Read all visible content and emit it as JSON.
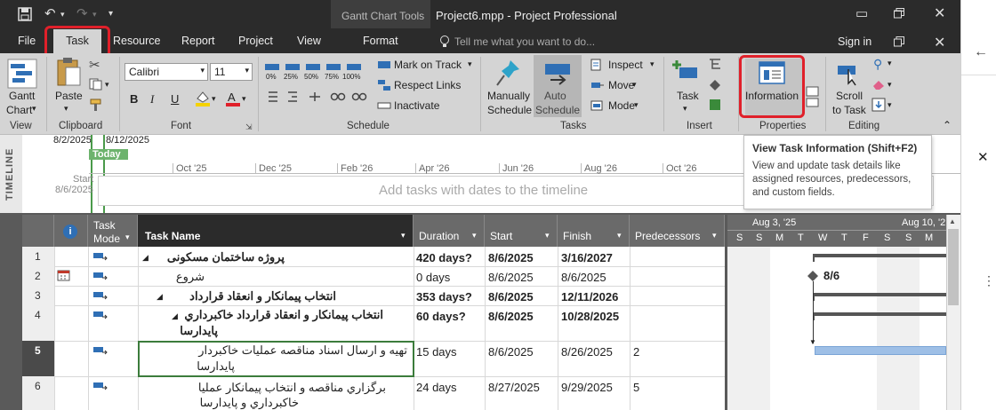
{
  "titlebar": {
    "context_tab": "Gantt Chart Tools",
    "title": "Project6.mpp  -  Project Professional"
  },
  "tabs": [
    "File",
    "Task",
    "Resource",
    "Report",
    "Project",
    "View",
    "Format"
  ],
  "tell_me": "Tell me what you want to do...",
  "sign_in": "Sign in",
  "ribbon": {
    "view": {
      "gantt_chart": "Gantt Chart",
      "gantt_line1": "Gantt",
      "gantt_line2": "Chart",
      "group": "View"
    },
    "clipboard": {
      "paste": "Paste",
      "group": "Clipboard"
    },
    "font": {
      "family": "Calibri",
      "size": "11",
      "bold": "B",
      "italic": "I",
      "underline": "U",
      "group": "Font"
    },
    "schedule": {
      "pct": [
        "0%",
        "25%",
        "50%",
        "75%",
        "100%"
      ],
      "mark_on_track": "Mark on Track",
      "respect_links": "Respect Links",
      "inactivate": "Inactivate",
      "group": "Schedule"
    },
    "tasks": {
      "manually_l1": "Manually",
      "manually_l2": "Schedule",
      "auto_l1": "Auto",
      "auto_l2": "Schedule",
      "inspect": "Inspect",
      "move": "Move",
      "mode": "Mode",
      "group": "Tasks"
    },
    "insert": {
      "task": "Task",
      "group": "Insert"
    },
    "properties": {
      "information": "Information",
      "group": "Properties"
    },
    "editing": {
      "scroll_l1": "Scroll",
      "scroll_l2": "to Task",
      "group": "Editing"
    }
  },
  "tooltip": {
    "title": "View Task Information (Shift+F2)",
    "body_l1": "View and update task details like",
    "body_l2": "assigned resources, predecessors,",
    "body_l3": "and custom fields."
  },
  "timeline": {
    "side_label": "TIMELINE",
    "date_left": "8/2/2025",
    "date_right": "8/12/2025",
    "today": "Today",
    "months": [
      "Oct '25",
      "Dec '25",
      "Feb '26",
      "Apr '26",
      "Jun '26",
      "Aug '26",
      "Oct '26"
    ],
    "start_label": "Start",
    "start_date": "8/6/2025",
    "placeholder": "Add tasks with dates to the timeline"
  },
  "grid": {
    "headers": {
      "task_mode_l1": "Task",
      "task_mode_l2": "Mode",
      "task_name": "Task Name",
      "duration": "Duration",
      "start": "Start",
      "finish": "Finish",
      "predecessors": "Predecessors"
    },
    "rows": [
      {
        "id": "1",
        "name": "پروژه ساختمان مسکونی",
        "duration": "420 days?",
        "start": "8/6/2025",
        "finish": "3/16/2027",
        "pred": ""
      },
      {
        "id": "2",
        "name": "شروع",
        "duration": "0 days",
        "start": "8/6/2025",
        "finish": "8/6/2025",
        "pred": ""
      },
      {
        "id": "3",
        "name": "انتخاب پیمانکار و انعقاد قرارداد",
        "duration": "353 days?",
        "start": "8/6/2025",
        "finish": "12/11/2026",
        "pred": ""
      },
      {
        "id": "4",
        "name_l1": "انتخاب پیمانکار و انعقاد قرارداد خاکبرداري و",
        "name_l2": "پایدارسازي",
        "duration": "60 days?",
        "start": "8/6/2025",
        "finish": "10/28/2025",
        "pred": ""
      },
      {
        "id": "5",
        "name_l1": "تهیه و ارسال اسناد مناقصه عملیات خاکبرداري و",
        "name_l2": "پایدارسازي",
        "duration": "15 days",
        "start": "8/6/2025",
        "finish": "8/26/2025",
        "pred": "2"
      },
      {
        "id": "6",
        "name_l1": "برگزاري مناقصه و انتخاب پیمانکار عملیات",
        "name_l2": "خاکبرداري و پایدارسازي",
        "duration": "24 days",
        "start": "8/27/2025",
        "finish": "9/29/2025",
        "pred": "5"
      }
    ]
  },
  "gantt": {
    "week1": "Aug 3, '25",
    "week2": "Aug 10, '2",
    "days": [
      "S",
      "S",
      "M",
      "T",
      "W",
      "T",
      "F",
      "S",
      "S",
      "M"
    ],
    "milestone_label": "8/6"
  },
  "colors": {
    "accent_red": "#e0202a",
    "bar": "#9ebfe6",
    "dark": "#2b2b2b"
  }
}
